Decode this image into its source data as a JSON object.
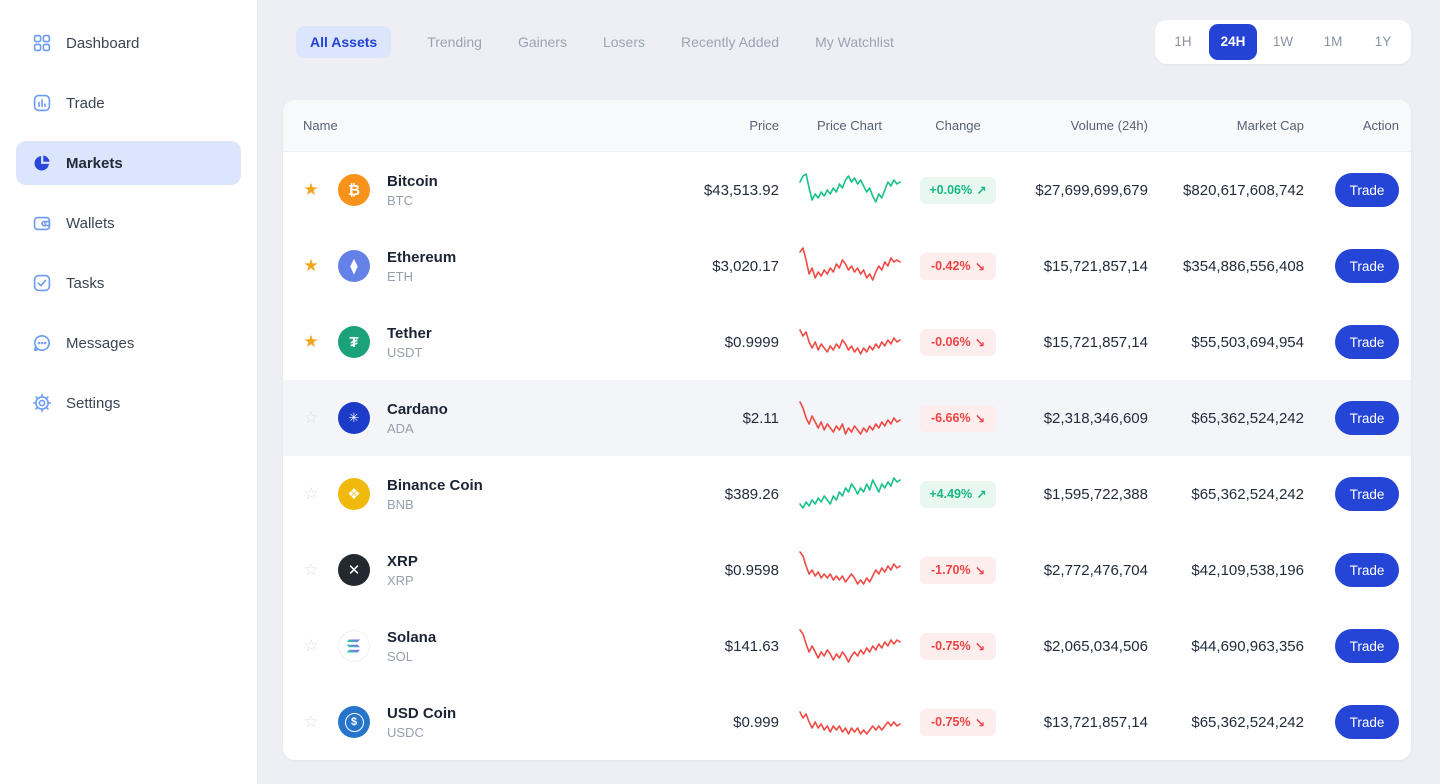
{
  "sidebar": {
    "items": [
      {
        "label": "Dashboard",
        "icon": "grid-icon",
        "active": false
      },
      {
        "label": "Trade",
        "icon": "trade-chart-icon",
        "active": false
      },
      {
        "label": "Markets",
        "icon": "pie-chart-icon",
        "active": true
      },
      {
        "label": "Wallets",
        "icon": "wallet-icon",
        "active": false
      },
      {
        "label": "Tasks",
        "icon": "tasks-check-icon",
        "active": false
      },
      {
        "label": "Messages",
        "icon": "messages-icon",
        "active": false
      },
      {
        "label": "Settings",
        "icon": "settings-gear-icon",
        "active": false
      }
    ]
  },
  "tabs": {
    "items": [
      {
        "label": "All Assets",
        "active": true
      },
      {
        "label": "Trending",
        "active": false
      },
      {
        "label": "Gainers",
        "active": false
      },
      {
        "label": "Losers",
        "active": false
      },
      {
        "label": "Recently Added",
        "active": false
      },
      {
        "label": "My Watchlist",
        "active": false
      }
    ]
  },
  "timeframes": {
    "items": [
      {
        "label": "1H",
        "active": false
      },
      {
        "label": "24H",
        "active": true
      },
      {
        "label": "1W",
        "active": false
      },
      {
        "label": "1M",
        "active": false
      },
      {
        "label": "1Y",
        "active": false
      }
    ]
  },
  "colors": {
    "accent_blue": "#2445d6",
    "active_pill_bg": "#dbe6fc",
    "positive": "#17b784",
    "negative": "#ee4343",
    "spark_up": "#18c08a",
    "spark_down": "#ef4b45",
    "star_gold": "#f2a71b"
  },
  "table": {
    "columns": {
      "name": "Name",
      "price": "Price",
      "chart": "Price Chart",
      "change": "Change",
      "volume": "Volume (24h)",
      "market_cap": "Market Cap",
      "action": "Action"
    },
    "trade_label": "Trade",
    "rows": [
      {
        "name": "Bitcoin",
        "symbol": "BTC",
        "price": "$43,513.92",
        "change": "+0.06%",
        "change_arrow": "↗",
        "direction": "up",
        "volume": "$27,699,699,679",
        "market_cap": "$820,617,608,742",
        "starred": true,
        "star_glyph": "★",
        "icon_glyph": "₿",
        "icon_bg": "#F7931A",
        "spark_color": "#18c08a",
        "spark": [
          14,
          8,
          6,
          20,
          32,
          26,
          30,
          24,
          28,
          22,
          26,
          20,
          24,
          16,
          20,
          12,
          8,
          14,
          10,
          16,
          12,
          18,
          24,
          20,
          28,
          34,
          26,
          30,
          22,
          14,
          18,
          12,
          16,
          14
        ]
      },
      {
        "name": "Ethereum",
        "symbol": "ETH",
        "price": "$3,020.17",
        "change": "-0.42%",
        "change_arrow": "↘",
        "direction": "down",
        "volume": "$15,721,857,14",
        "market_cap": "$354,886,556,408",
        "starred": true,
        "star_glyph": "★",
        "icon_glyph": "⧫",
        "icon_bg": "#6481E7",
        "spark_color": "#ef4b45",
        "spark": [
          8,
          4,
          16,
          30,
          24,
          34,
          28,
          32,
          26,
          30,
          24,
          28,
          20,
          24,
          16,
          20,
          26,
          22,
          28,
          24,
          30,
          26,
          34,
          30,
          36,
          28,
          22,
          26,
          18,
          22,
          14,
          18,
          16,
          18
        ]
      },
      {
        "name": "Tether",
        "symbol": "USDT",
        "price": "$0.9999",
        "change": "-0.06%",
        "change_arrow": "↘",
        "direction": "down",
        "volume": "$15,721,857,14",
        "market_cap": "$55,503,694,954",
        "starred": true,
        "star_glyph": "★",
        "icon_glyph": "₮",
        "icon_bg": "#1BA27A",
        "spark_color": "#ef4b45",
        "spark": [
          10,
          16,
          12,
          22,
          28,
          22,
          30,
          24,
          28,
          32,
          26,
          30,
          24,
          28,
          20,
          24,
          30,
          26,
          32,
          28,
          34,
          28,
          32,
          26,
          30,
          24,
          28,
          22,
          26,
          20,
          24,
          18,
          22,
          20
        ]
      },
      {
        "name": "Cardano",
        "symbol": "ADA",
        "price": "$2.11",
        "change": "-6.66%",
        "change_arrow": "↘",
        "direction": "down",
        "volume": "$2,318,346,609",
        "market_cap": "$65,362,524,242",
        "starred": false,
        "star_glyph": "☆",
        "highlighted": true,
        "icon_glyph": "✳",
        "icon_bg": "#1B3BC8",
        "spark_color": "#ef4b45",
        "spark": [
          6,
          12,
          22,
          28,
          20,
          26,
          32,
          26,
          34,
          28,
          32,
          36,
          30,
          34,
          28,
          38,
          32,
          36,
          30,
          34,
          38,
          32,
          36,
          30,
          34,
          28,
          32,
          26,
          30,
          24,
          28,
          22,
          26,
          24
        ]
      },
      {
        "name": "Binance Coin",
        "symbol": "BNB",
        "price": "$389.26",
        "change": "+4.49%",
        "change_arrow": "↗",
        "direction": "up",
        "volume": "$1,595,722,388",
        "market_cap": "$65,362,524,242",
        "starred": false,
        "star_glyph": "☆",
        "icon_glyph": "❖",
        "icon_bg": "#F0B90B",
        "spark_color": "#18c08a",
        "spark": [
          32,
          36,
          30,
          34,
          28,
          32,
          26,
          30,
          24,
          28,
          32,
          24,
          28,
          20,
          24,
          16,
          20,
          12,
          16,
          22,
          16,
          20,
          12,
          18,
          8,
          14,
          20,
          12,
          16,
          10,
          14,
          6,
          10,
          8
        ]
      },
      {
        "name": "XRP",
        "symbol": "XRP",
        "price": "$0.9598",
        "change": "-1.70%",
        "change_arrow": "↘",
        "direction": "down",
        "volume": "$2,772,476,704",
        "market_cap": "$42,109,538,196",
        "starred": false,
        "star_glyph": "☆",
        "icon_glyph": "✕",
        "icon_bg": "#23292F",
        "spark_color": "#ef4b45",
        "spark": [
          4,
          8,
          18,
          26,
          22,
          28,
          24,
          30,
          26,
          30,
          26,
          32,
          28,
          32,
          28,
          34,
          30,
          26,
          30,
          36,
          32,
          36,
          30,
          34,
          28,
          22,
          26,
          20,
          24,
          18,
          22,
          16,
          20,
          18
        ]
      },
      {
        "name": "Solana",
        "symbol": "SOL",
        "price": "$141.63",
        "change": "-0.75%",
        "change_arrow": "↘",
        "direction": "down",
        "volume": "$2,065,034,506",
        "market_cap": "$44,690,963,356",
        "starred": false,
        "star_glyph": "☆",
        "icon_glyph": "",
        "icon_bg": "#FFFFFF",
        "spark_color": "#ef4b45",
        "spark": [
          6,
          10,
          20,
          28,
          22,
          28,
          34,
          28,
          32,
          26,
          30,
          36,
          30,
          34,
          28,
          32,
          38,
          32,
          28,
          32,
          26,
          30,
          24,
          28,
          22,
          26,
          20,
          24,
          18,
          22,
          16,
          20,
          16,
          18
        ]
      },
      {
        "name": "USD Coin",
        "symbol": "USDC",
        "price": "$0.999",
        "change": "-0.75%",
        "change_arrow": "↘",
        "direction": "down",
        "volume": "$13,721,857,14",
        "market_cap": "$65,362,524,242",
        "starred": false,
        "star_glyph": "☆",
        "icon_glyph": "$",
        "icon_bg": "#2775CA",
        "spark_color": "#ef4b45",
        "spark": [
          12,
          18,
          14,
          22,
          28,
          22,
          28,
          24,
          30,
          26,
          32,
          26,
          30,
          26,
          32,
          28,
          34,
          28,
          32,
          28,
          34,
          30,
          34,
          30,
          26,
          30,
          26,
          30,
          26,
          22,
          26,
          22,
          26,
          24
        ]
      }
    ]
  }
}
